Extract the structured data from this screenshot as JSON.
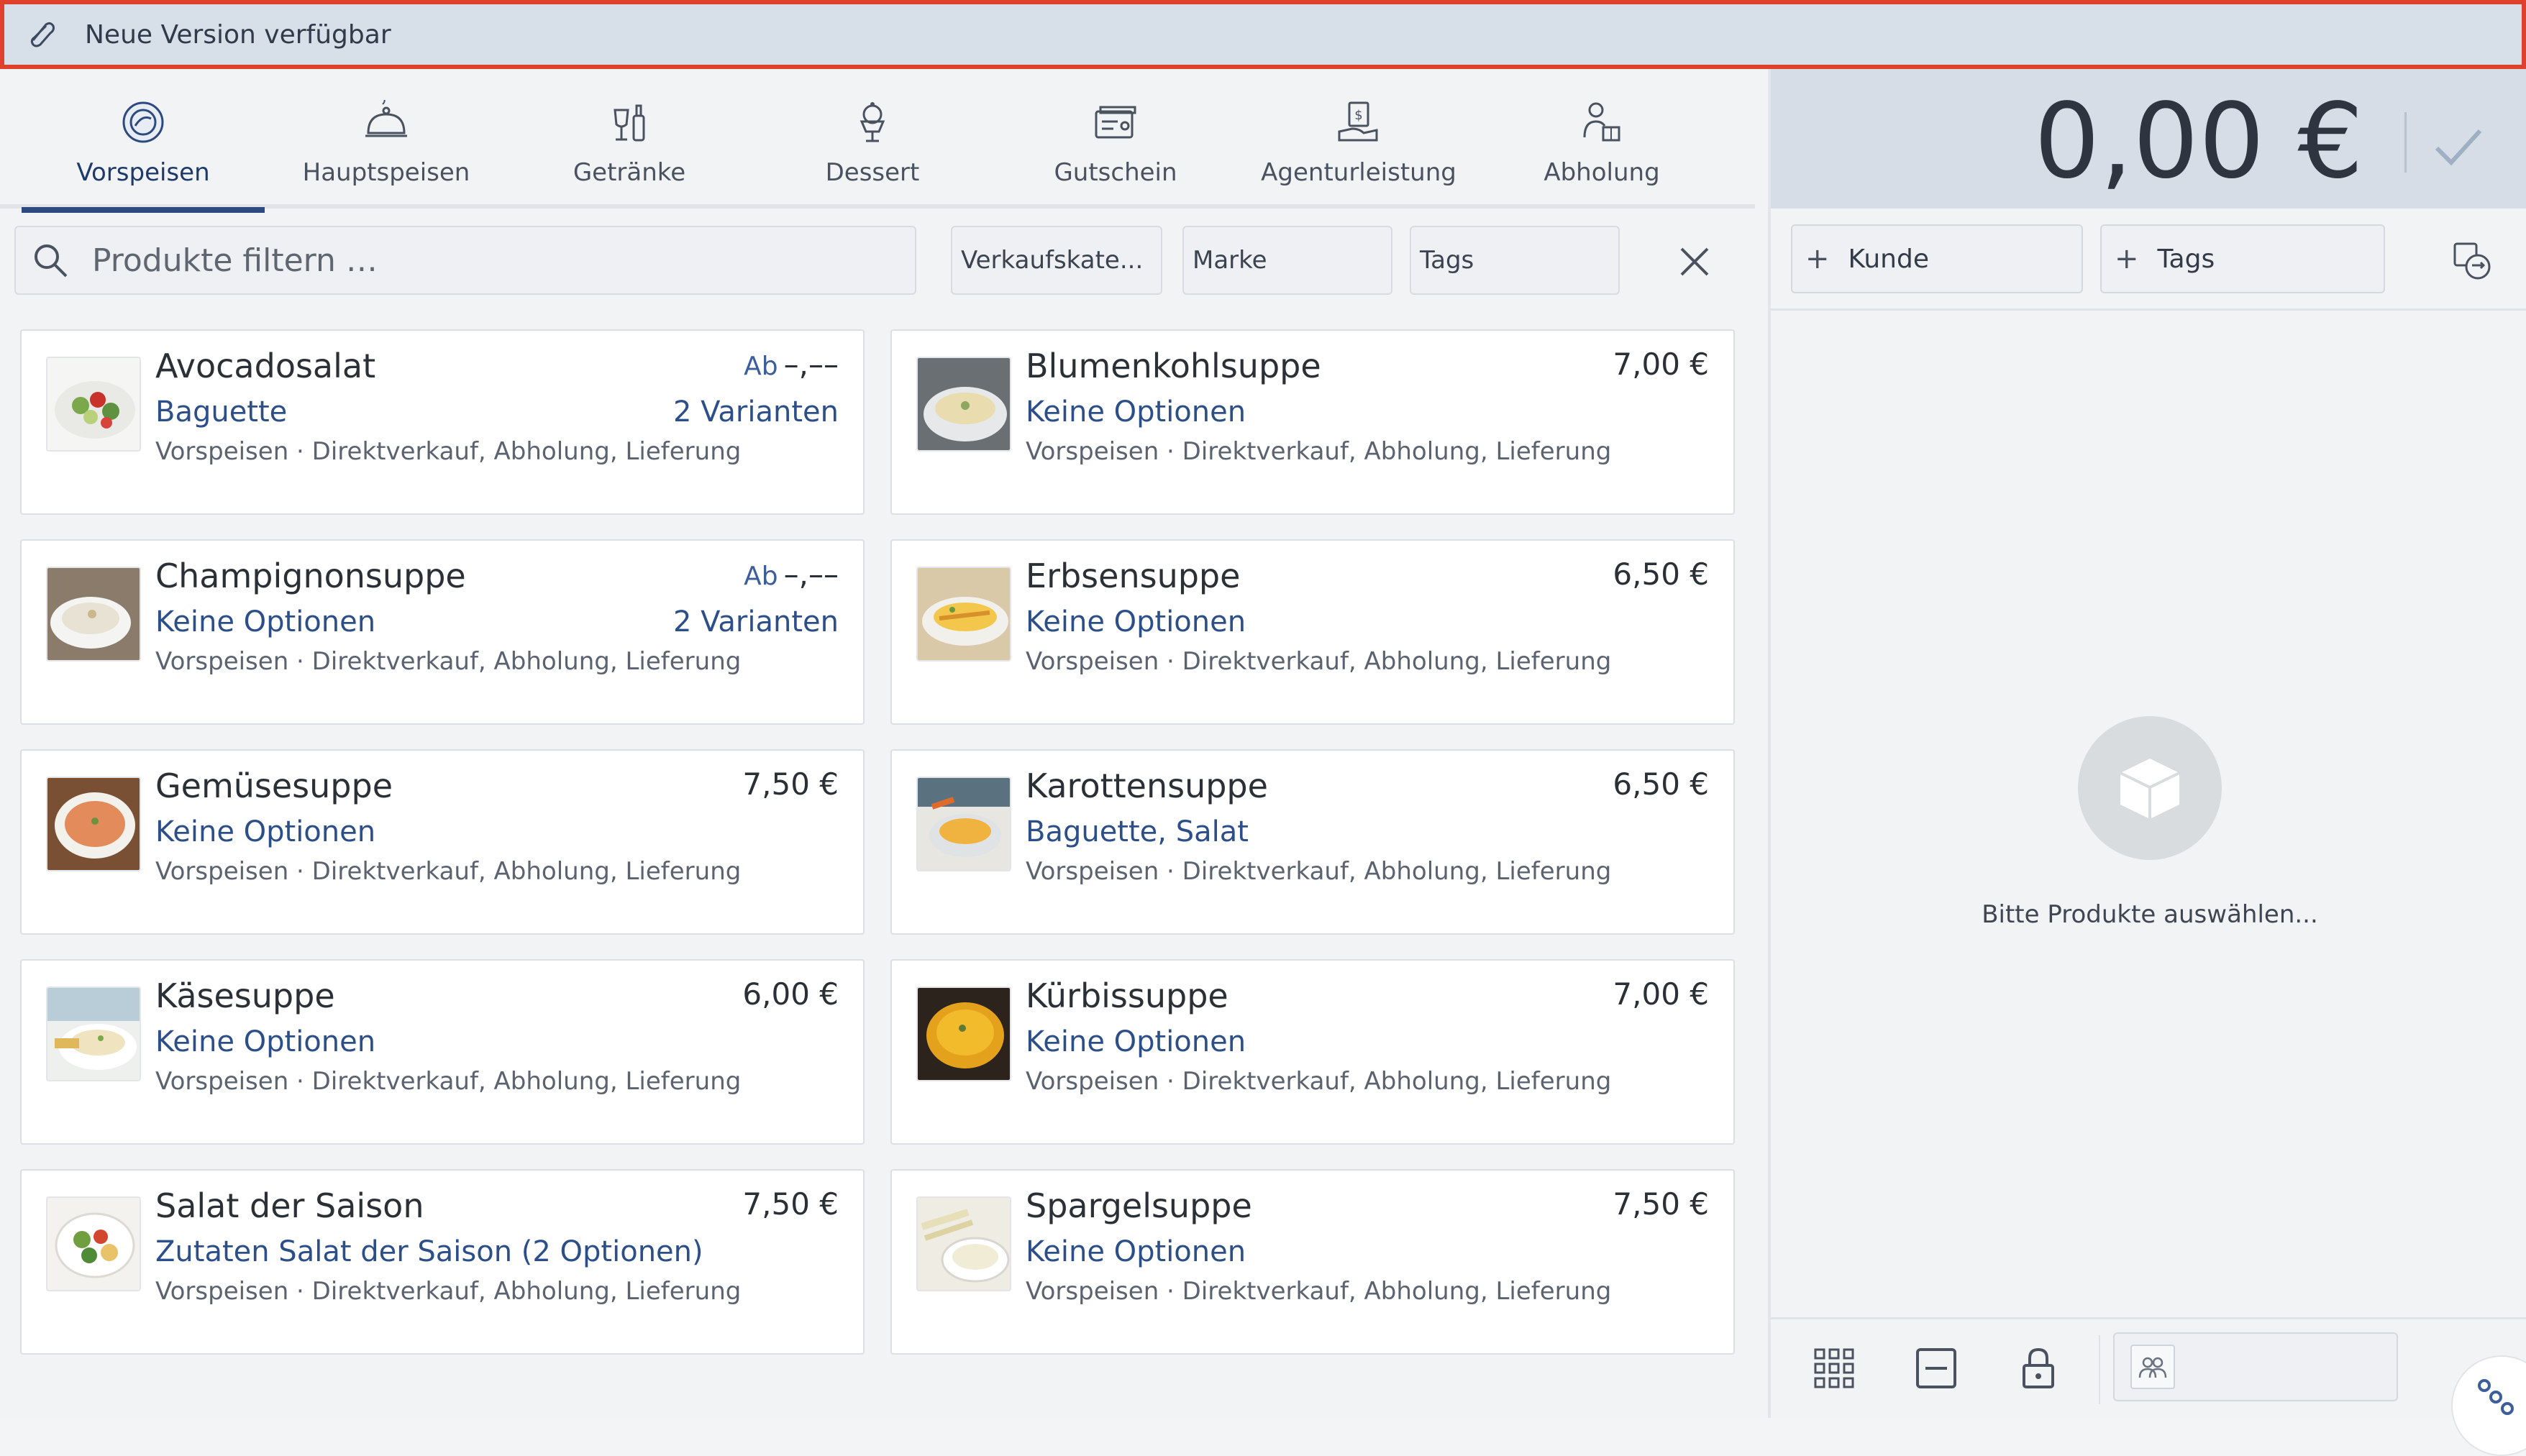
{
  "banner": {
    "text": "Neue Version verfügbar"
  },
  "tabs": [
    {
      "label": "Vorspeisen",
      "icon": "appetizer-icon",
      "active": true
    },
    {
      "label": "Hauptspeisen",
      "icon": "cloche-icon",
      "active": false
    },
    {
      "label": "Getränke",
      "icon": "drinks-icon",
      "active": false
    },
    {
      "label": "Dessert",
      "icon": "dessert-icon",
      "active": false
    },
    {
      "label": "Gutschein",
      "icon": "voucher-icon",
      "active": false
    },
    {
      "label": "Agenturleistung",
      "icon": "agency-service-icon",
      "active": false
    },
    {
      "label": "Abholung",
      "icon": "pickup-icon",
      "active": false
    }
  ],
  "filters": {
    "search_placeholder": "Produkte filtern …",
    "category": "Verkaufskate...",
    "brand": "Marke",
    "tags": "Tags"
  },
  "products": [
    {
      "name": "Avocadosalat",
      "options": "Baguette",
      "meta": "Vorspeisen · Direktverkauf, Abholung, Lieferung",
      "price_prefix": "Ab",
      "price": "–,––",
      "variants": "2 Varianten",
      "img": "salad"
    },
    {
      "name": "Blumenkohlsuppe",
      "options": "Keine Optionen",
      "meta": "Vorspeisen · Direktverkauf, Abholung, Lieferung",
      "price_prefix": "",
      "price": "7,00 €",
      "variants": "",
      "img": "soup-light"
    },
    {
      "name": "Champignonsuppe",
      "options": "Keine Optionen",
      "meta": "Vorspeisen · Direktverkauf, Abholung, Lieferung",
      "price_prefix": "Ab",
      "price": "–,––",
      "variants": "2 Varianten",
      "img": "soup-white"
    },
    {
      "name": "Erbsensuppe",
      "options": "Keine Optionen",
      "meta": "Vorspeisen · Direktverkauf, Abholung, Lieferung",
      "price_prefix": "",
      "price": "6,50 €",
      "variants": "",
      "img": "omelette"
    },
    {
      "name": "Gemüsesuppe",
      "options": "Keine Optionen",
      "meta": "Vorspeisen · Direktverkauf, Abholung, Lieferung",
      "price_prefix": "",
      "price": "7,50 €",
      "variants": "",
      "img": "soup-orange"
    },
    {
      "name": "Karottensuppe",
      "options": "Baguette, Salat",
      "meta": "Vorspeisen · Direktverkauf, Abholung, Lieferung",
      "price_prefix": "",
      "price": "6,50 €",
      "variants": "",
      "img": "soup-carrot"
    },
    {
      "name": "Käsesuppe",
      "options": "Keine Optionen",
      "meta": "Vorspeisen · Direktverkauf, Abholung, Lieferung",
      "price_prefix": "",
      "price": "6,00 €",
      "variants": "",
      "img": "soup-cheese"
    },
    {
      "name": "Kürbissuppe",
      "options": "Keine Optionen",
      "meta": "Vorspeisen · Direktverkauf, Abholung, Lieferung",
      "price_prefix": "",
      "price": "7,00 €",
      "variants": "",
      "img": "soup-pumpkin"
    },
    {
      "name": "Salat der Saison",
      "options": "Zutaten Salat der Saison (2 Optionen)",
      "meta": "Vorspeisen · Direktverkauf, Abholung, Lieferung",
      "price_prefix": "",
      "price": "7,50 €",
      "variants": "",
      "img": "salad-bowl"
    },
    {
      "name": "Spargelsuppe",
      "options": "Keine Optionen",
      "meta": "Vorspeisen · Direktverkauf, Abholung, Lieferung",
      "price_prefix": "",
      "price": "7,50 €",
      "variants": "",
      "img": "soup-asparagus"
    }
  ],
  "cart": {
    "total": "0,00 €",
    "customer_button": "Kunde",
    "tags_button": "Tags",
    "empty_message": "Bitte Produkte auswählen..."
  },
  "colors": {
    "accent": "#2c4a80",
    "banner_border": "#e0412d",
    "banner_bg": "#d7dfe8",
    "link": "#2c4f8a"
  }
}
